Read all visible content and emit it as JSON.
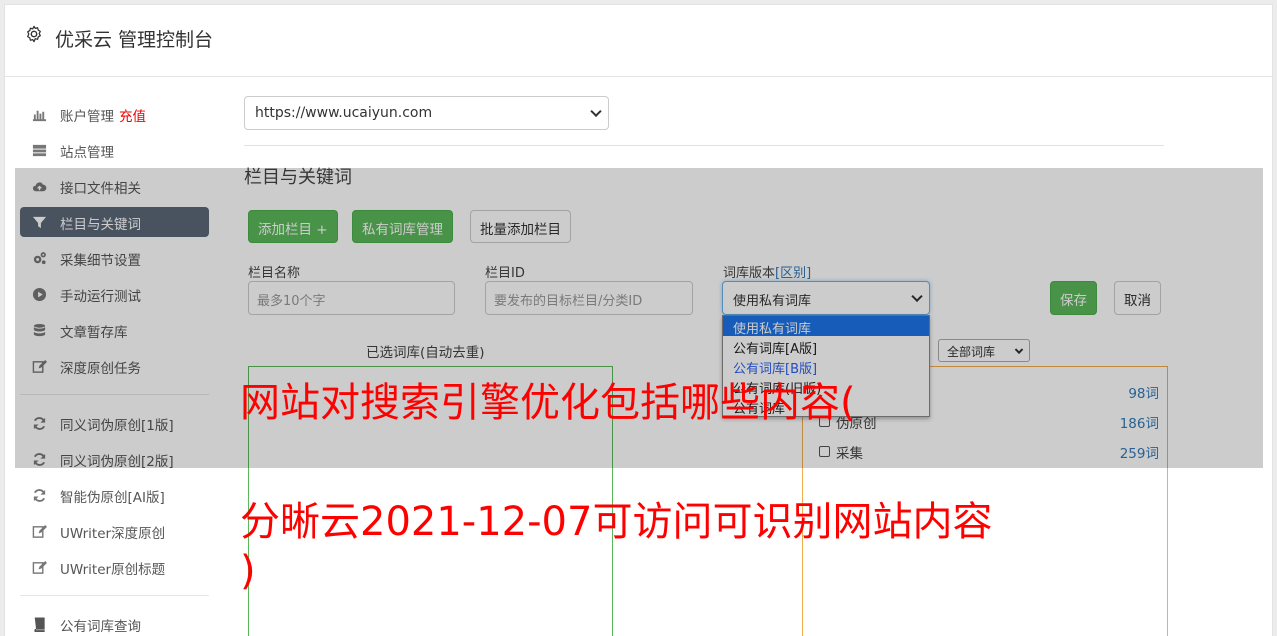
{
  "header": {
    "title": "优采云 管理控制台"
  },
  "sidebar": {
    "items": [
      {
        "label": "账户管理",
        "extra": "充值",
        "icon": "bar-chart-icon"
      },
      {
        "label": "站点管理",
        "icon": "server-icon"
      },
      {
        "label": "接口文件相关",
        "icon": "cloud-upload-icon"
      },
      {
        "label": "栏目与关键词",
        "icon": "filter-icon",
        "active": true
      },
      {
        "label": "采集细节设置",
        "icon": "cogs-icon"
      },
      {
        "label": "手动运行测试",
        "icon": "play-circle-icon"
      },
      {
        "label": "文章暂存库",
        "icon": "database-icon"
      },
      {
        "label": "深度原创任务",
        "icon": "edit-icon"
      },
      {
        "label": "同义词伪原创[1版]",
        "icon": "refresh-icon"
      },
      {
        "label": "同义词伪原创[2版]",
        "icon": "refresh-icon"
      },
      {
        "label": "智能伪原创[AI版]",
        "icon": "refresh-icon"
      },
      {
        "label": "UWriter深度原创",
        "icon": "edit-icon"
      },
      {
        "label": "UWriter原创标题",
        "icon": "edit-icon"
      },
      {
        "label": "公有词库查询",
        "icon": "book-icon"
      }
    ]
  },
  "main": {
    "site_select_value": "https://www.ucaiyun.com",
    "section_title": "栏目与关键词",
    "buttons": {
      "add_column": "添加栏目 +",
      "private_lib": "私有词库管理",
      "batch_add": "批量添加栏目"
    },
    "fields": {
      "column_name_label": "栏目名称",
      "column_name_placeholder": "最多10个字",
      "column_id_label": "栏目ID",
      "column_id_placeholder": "要发布的目标栏目/分类ID",
      "version_label": "词库版本",
      "version_link": "[区别]",
      "version_value": "使用私有词库"
    },
    "version_options": [
      "使用私有词库",
      "公有词库[A版]",
      "公有词库[B版]",
      "公有词库(旧版)",
      "公有词库"
    ],
    "save": "保存",
    "cancel": "取消",
    "selected_lib_title": "已选词库(自动去重)",
    "lib_filter_value": "全部词库",
    "lib_rows": [
      {
        "name": "",
        "count": "98词"
      },
      {
        "name": "伪原创",
        "count": "186词"
      },
      {
        "name": "采集",
        "count": "259词"
      }
    ]
  },
  "watermark": {
    "line1": "网站对搜索引擎优化包括哪些内容(",
    "line2": "分晰云2021-12-07可访问可识别网站内容",
    "line3": ")"
  }
}
